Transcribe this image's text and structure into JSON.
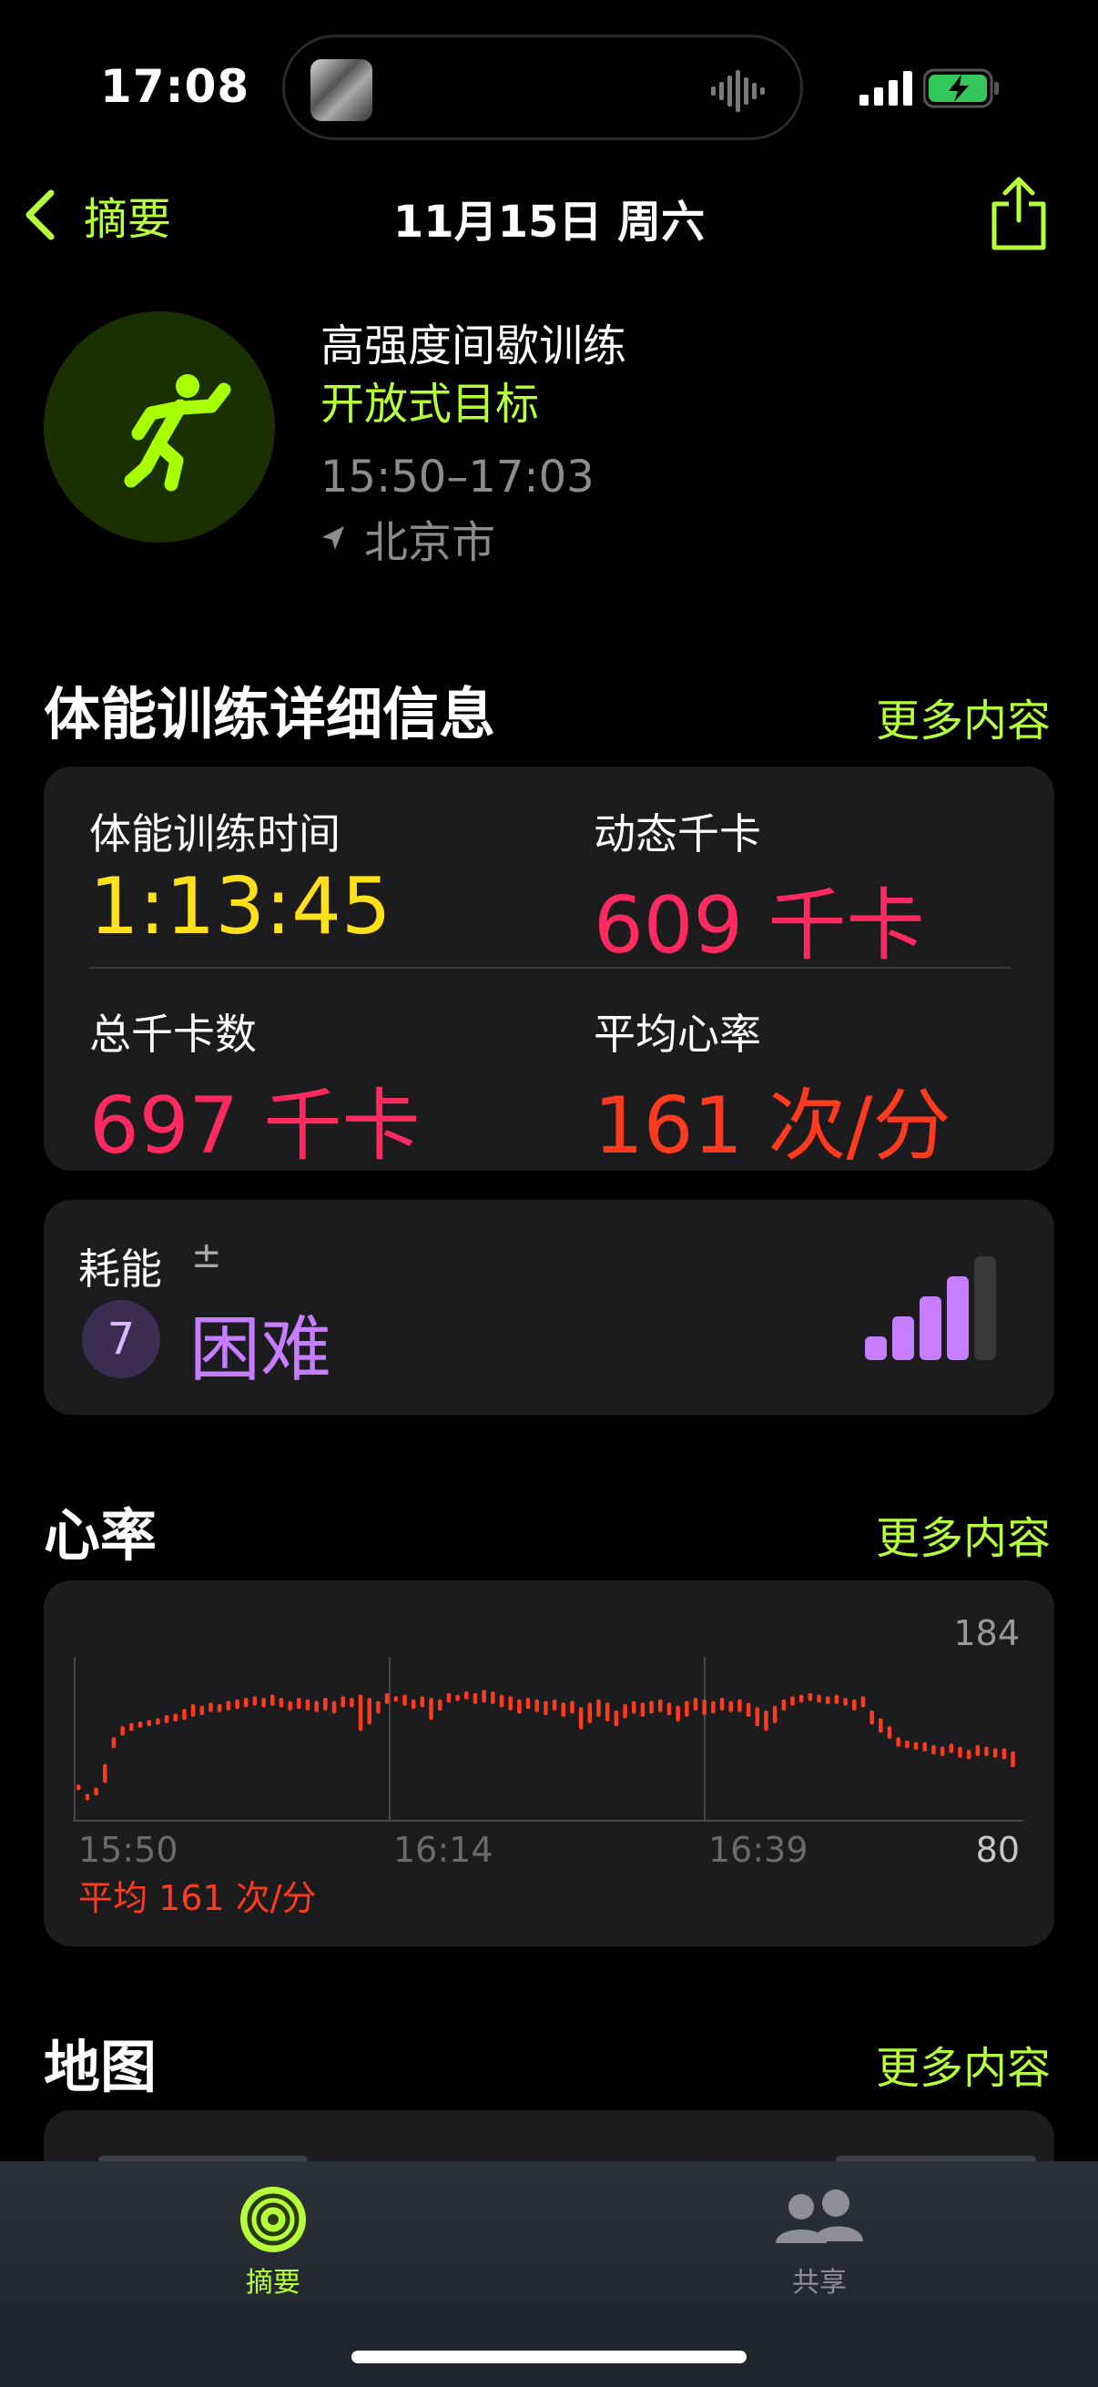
{
  "status": {
    "time": "17:08"
  },
  "nav": {
    "back_label": "摘要",
    "title": "11月15日 周六"
  },
  "workout": {
    "name": "高强度间歇训练",
    "goal": "开放式目标",
    "time_range": "15:50–17:03",
    "location": "北京市"
  },
  "details": {
    "title": "体能训练详细信息",
    "more": "更多内容",
    "metrics": [
      {
        "label": "体能训练时间",
        "value": "1:13:45",
        "color": "#ffe01b"
      },
      {
        "label": "动态千卡",
        "value": "609 千卡",
        "color": "#ff2a5f"
      },
      {
        "label": "总千卡数",
        "value": "697 千卡",
        "color": "#ff2a5f"
      },
      {
        "label": "平均心率",
        "value": "161 次/分",
        "color": "#ff3b1f"
      }
    ]
  },
  "effort": {
    "label": "耗能",
    "adjust": "±",
    "level": "7",
    "text": "困难",
    "max_level": 10
  },
  "heart": {
    "title": "心率",
    "more": "更多内容",
    "average": "平均 161 次/分"
  },
  "map": {
    "title": "地图",
    "more": "更多内容"
  },
  "tabbar": {
    "tabs": [
      {
        "label": "摘要",
        "active": true
      },
      {
        "label": "共享",
        "active": false
      }
    ]
  },
  "colors": {
    "accent": "#b6ff3b",
    "heart": "#ff3b1f",
    "effort": "#c77dff",
    "card": "#1c1c1e"
  },
  "chart_data": {
    "type": "bar",
    "ylim": [
      80,
      184
    ],
    "x_ticks": [
      "15:50",
      "16:14",
      "16:39"
    ],
    "y_ticks": [
      184,
      80
    ],
    "bars": [
      [
        103,
        100
      ],
      [
        97,
        93
      ],
      [
        101,
        96
      ],
      [
        116,
        104
      ],
      [
        133,
        126
      ],
      [
        140,
        134
      ],
      [
        142,
        137
      ],
      [
        143,
        139
      ],
      [
        144,
        140
      ],
      [
        145,
        141
      ],
      [
        147,
        142
      ],
      [
        148,
        143
      ],
      [
        151,
        144
      ],
      [
        154,
        146
      ],
      [
        153,
        147
      ],
      [
        155,
        149
      ],
      [
        154,
        149
      ],
      [
        156,
        150
      ],
      [
        157,
        151
      ],
      [
        158,
        152
      ],
      [
        159,
        153
      ],
      [
        158,
        152
      ],
      [
        160,
        153
      ],
      [
        158,
        152
      ],
      [
        156,
        150
      ],
      [
        158,
        151
      ],
      [
        157,
        150
      ],
      [
        156,
        149
      ],
      [
        158,
        150
      ],
      [
        156,
        148
      ],
      [
        159,
        152
      ],
      [
        158,
        152
      ],
      [
        160,
        137
      ],
      [
        158,
        141
      ],
      [
        156,
        148
      ],
      [
        161,
        154
      ],
      [
        159,
        156
      ],
      [
        160,
        153
      ],
      [
        157,
        151
      ],
      [
        159,
        152
      ],
      [
        158,
        144
      ],
      [
        157,
        150
      ],
      [
        161,
        155
      ],
      [
        160,
        156
      ],
      [
        162,
        157
      ],
      [
        161,
        154
      ],
      [
        163,
        155
      ],
      [
        162,
        154
      ],
      [
        160,
        152
      ],
      [
        159,
        150
      ],
      [
        157,
        148
      ],
      [
        158,
        151
      ],
      [
        157,
        149
      ],
      [
        156,
        147
      ],
      [
        157,
        150
      ],
      [
        155,
        146
      ],
      [
        156,
        148
      ],
      [
        152,
        138
      ],
      [
        155,
        142
      ],
      [
        157,
        146
      ],
      [
        155,
        143
      ],
      [
        150,
        140
      ],
      [
        154,
        145
      ],
      [
        156,
        148
      ],
      [
        155,
        146
      ],
      [
        156,
        148
      ],
      [
        157,
        149
      ],
      [
        155,
        147
      ],
      [
        153,
        143
      ],
      [
        156,
        146
      ],
      [
        158,
        150
      ],
      [
        157,
        147
      ],
      [
        156,
        148
      ],
      [
        158,
        150
      ],
      [
        156,
        149
      ],
      [
        157,
        149
      ],
      [
        155,
        146
      ],
      [
        152,
        140
      ],
      [
        150,
        137
      ],
      [
        153,
        142
      ],
      [
        157,
        150
      ],
      [
        159,
        153
      ],
      [
        160,
        155
      ],
      [
        161,
        156
      ],
      [
        160,
        155
      ],
      [
        159,
        154
      ],
      [
        160,
        154
      ],
      [
        158,
        153
      ],
      [
        157,
        150
      ],
      [
        159,
        152
      ],
      [
        150,
        141
      ],
      [
        145,
        136
      ],
      [
        140,
        132
      ],
      [
        133,
        127
      ],
      [
        131,
        126
      ],
      [
        130,
        125
      ],
      [
        130,
        124
      ],
      [
        128,
        122
      ],
      [
        127,
        121
      ],
      [
        129,
        123
      ],
      [
        127,
        120
      ],
      [
        125,
        119
      ],
      [
        128,
        121
      ],
      [
        127,
        121
      ],
      [
        126,
        120
      ],
      [
        126,
        119
      ],
      [
        124,
        114
      ]
    ]
  }
}
